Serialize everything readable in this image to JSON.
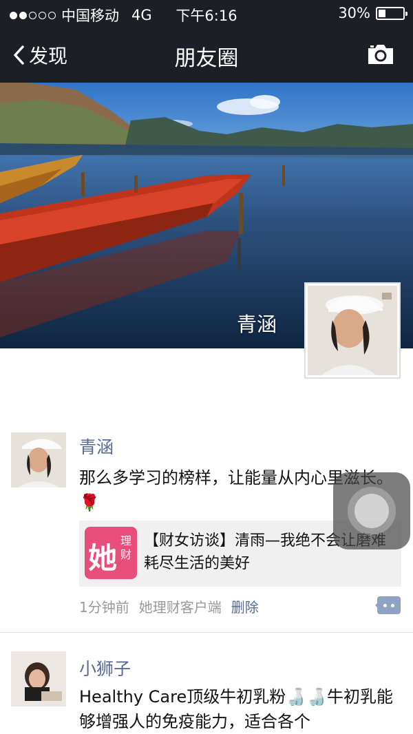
{
  "status_bar": {
    "carrier": "中国移动",
    "network": "4G",
    "time": "下午6:16",
    "battery": "30%",
    "battery_level": 0.3
  },
  "nav": {
    "back_label": "发现",
    "title": "朋友圈"
  },
  "cover": {
    "user_name": "青涵"
  },
  "posts": [
    {
      "author": "青涵",
      "text": "那么多学习的榜样，让能量从内心里滋长。🌹",
      "link": {
        "logo_big": "她",
        "logo_small": "理财",
        "title": "【财女访谈】清雨—我绝不会让磨难耗尽生活的美好"
      },
      "time": "1分钟前",
      "source": "她理财客户端",
      "delete_label": "删除"
    },
    {
      "author": "小狮子",
      "text": "Healthy Care顶级牛初乳粉🍶🍶牛初乳能够增强人的免疫能力，适合各个"
    }
  ]
}
